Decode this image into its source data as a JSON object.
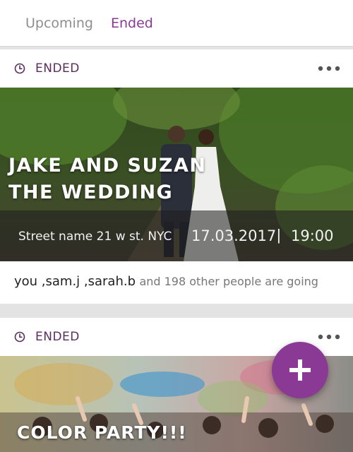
{
  "tabs": [
    {
      "label": "Upcoming",
      "active": false
    },
    {
      "label": "Ended",
      "active": true
    }
  ],
  "colors": {
    "accent": "#8a3a94",
    "status_text": "#5a2d60",
    "inactive_tab": "#8e8e8e"
  },
  "events": [
    {
      "status": "ENDED",
      "title_line1": "JAKE AND SUZAN",
      "title_line2": "THE WEDDING",
      "address": "Street name 21 w st. NYC",
      "date": "17.03.2017",
      "separator": "|",
      "time": "19:00",
      "attendees_names": "you ,sam.j ,sarah.b",
      "attendees_rest": "and 198 other people are going"
    },
    {
      "status": "ENDED",
      "title": "COLOR PARTY!!!"
    }
  ],
  "fab": {
    "icon": "plus-icon"
  }
}
